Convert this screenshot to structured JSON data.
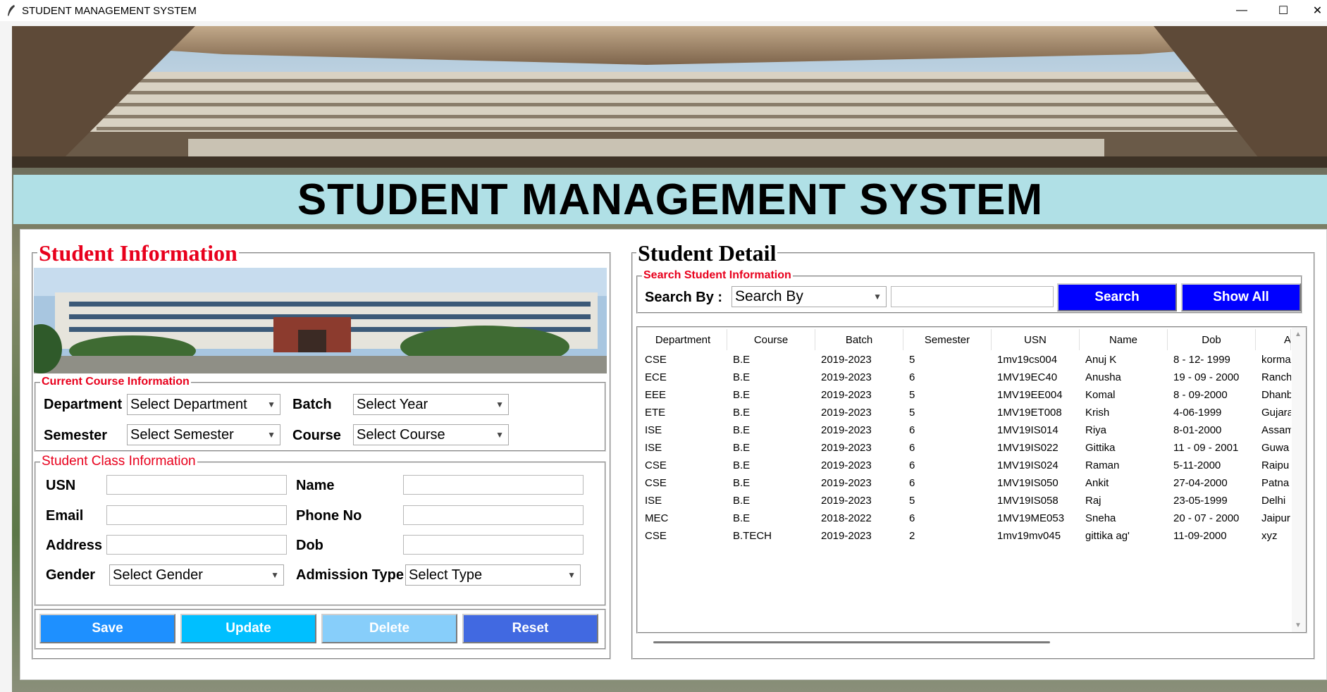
{
  "window": {
    "title": "STUDENT MANAGEMENT SYSTEM",
    "minimize_icon": "minimize-icon",
    "maximize_icon": "maximize-icon",
    "close_icon": "close-icon"
  },
  "heading": "STUDENT MANAGEMENT SYSTEM",
  "student_info": {
    "title": "Student Information",
    "course_frame": {
      "title": "Current Course Information",
      "department_label": "Department",
      "department_value": "Select Department",
      "batch_label": "Batch",
      "batch_value": "Select Year",
      "semester_label": "Semester",
      "semester_value": "Select Semester",
      "course_label": "Course",
      "course_value": "Select Course"
    },
    "class_frame": {
      "title": "Student Class Information",
      "usn_label": "USN",
      "usn_value": "",
      "name_label": "Name",
      "name_value": "",
      "email_label": "Email",
      "email_value": "",
      "phone_label": "Phone No",
      "phone_value": "",
      "address_label": "Address",
      "address_value": "",
      "dob_label": "Dob",
      "dob_value": "",
      "gender_label": "Gender",
      "gender_value": "Select Gender",
      "admission_label": "Admission Type",
      "admission_value": "Select Type"
    },
    "buttons": {
      "save": "Save",
      "update": "Update",
      "delete": "Delete",
      "reset": "Reset"
    }
  },
  "student_detail": {
    "title": "Student Detail",
    "search_frame": {
      "title": "Search Student Information",
      "search_by_label": "Search By :",
      "search_by_value": "Search By",
      "search_text": "",
      "search_button": "Search",
      "show_all_button": "Show All"
    },
    "table": {
      "columns": [
        "Department",
        "Course",
        "Batch",
        "Semester",
        "USN",
        "Name",
        "Dob",
        "A"
      ],
      "rows": [
        [
          "CSE",
          "B.E",
          "2019-2023",
          "5",
          "1mv19cs004",
          "Anuj K",
          "8 - 12- 1999",
          "korma"
        ],
        [
          "ECE",
          "B.E",
          "2019-2023",
          "6",
          "1MV19EC40",
          "Anusha",
          "19 - 09 - 2000",
          "Ranch"
        ],
        [
          "EEE",
          "B.E",
          "2019-2023",
          "5",
          "1MV19EE004",
          "Komal",
          "8 - 09-2000",
          "Dhanb"
        ],
        [
          "ETE",
          "B.E",
          "2019-2023",
          "5",
          "1MV19ET008",
          "Krish",
          "4-06-1999",
          "Gujara"
        ],
        [
          "ISE",
          "B.E",
          "2019-2023",
          "6",
          "1MV19IS014",
          "Riya",
          "8-01-2000",
          "Assam"
        ],
        [
          "ISE",
          "B.E",
          "2019-2023",
          "6",
          "1MV19IS022",
          "Gittika",
          "11 - 09 - 2001",
          "Guwa"
        ],
        [
          "CSE",
          "B.E",
          "2019-2023",
          "6",
          "1MV19IS024",
          "Raman",
          "5-11-2000",
          "Raipu"
        ],
        [
          "CSE",
          "B.E",
          "2019-2023",
          "6",
          "1MV19IS050",
          "Ankit",
          "27-04-2000",
          "Patna"
        ],
        [
          "ISE",
          "B.E",
          "2019-2023",
          "5",
          "1MV19IS058",
          "Raj",
          "23-05-1999",
          "Delhi"
        ],
        [
          "MEC",
          "B.E",
          "2018-2022",
          "6",
          "1MV19ME053",
          "Sneha",
          "20 - 07 - 2000",
          "Jaipur"
        ],
        [
          "CSE",
          "B.TECH",
          "2019-2023",
          "2",
          "1mv19mv045",
          "gittika ag'",
          "11-09-2000",
          "xyz"
        ]
      ]
    }
  },
  "colors": {
    "heading_bg": "#b0e0e6",
    "red_title": "#e8001c",
    "search_btn": "#0000ff",
    "show_all_btn": "#0000ff",
    "save_btn": "#1e90ff",
    "update_btn": "#00bfff",
    "delete_btn": "#87cefa",
    "reset_btn": "#4169e1"
  }
}
